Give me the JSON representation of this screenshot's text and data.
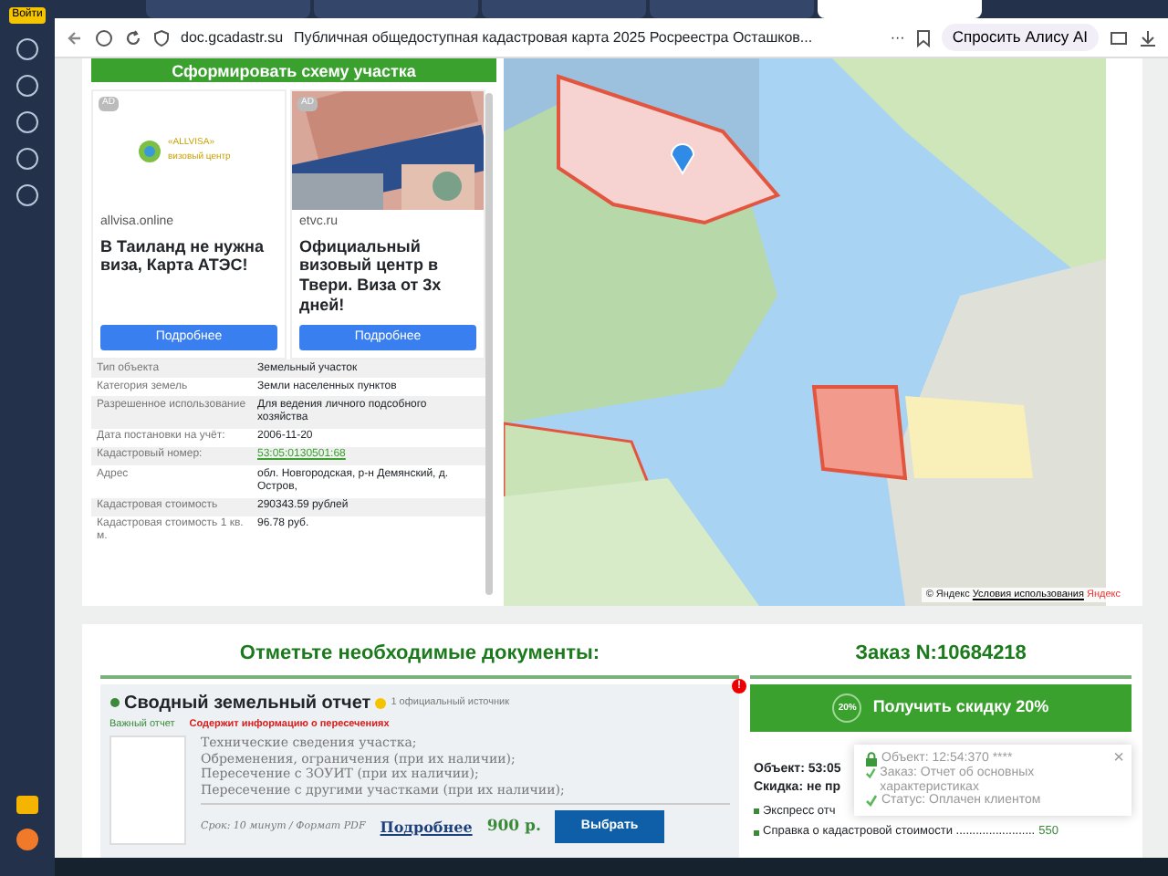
{
  "browser": {
    "login_badge": "Войти",
    "url": "doc.gcadastr.su",
    "page_title": "Публичная общедоступная кадастровая карта 2025 Росреестра Осташков...",
    "more": "···",
    "alice_button": "Спросить Алису AI"
  },
  "tabs": [
    {
      "selected": false
    },
    {
      "selected": false
    },
    {
      "selected": false
    },
    {
      "selected": false
    },
    {
      "selected": true
    }
  ],
  "top_button": "Сформировать схему участка",
  "ads": [
    {
      "ad_mark": "AD",
      "logo_text": "«ALLVISA» визовый центр",
      "domain": "allvisa.online",
      "headline": "В Таиланд не нужна виза, Карта АТЭС!",
      "button": "Подробнее",
      "kind": "logo"
    },
    {
      "ad_mark": "AD",
      "domain": "etvc.ru",
      "headline": "Официальный визовый центр в Твери. Виза от 3х дней!",
      "button": "Подробнее",
      "kind": "picture"
    }
  ],
  "properties": [
    {
      "label": "Тип объекта",
      "value": "Земельный участок",
      "kind": "text"
    },
    {
      "label": "Категория земель",
      "value": "Земли населенных пунктов",
      "kind": "text"
    },
    {
      "label": "Разрешенное использование",
      "value": "Для ведения личного подсобного хозяйства",
      "kind": "text"
    },
    {
      "label": "Дата постановки на учёт:",
      "value": "2006-11-20",
      "kind": "text"
    },
    {
      "label": "Кадастровый номер:",
      "value": "53:05:0130501:68",
      "kind": "link"
    },
    {
      "label": "Адрес",
      "value": "обл. Новгородская, р-н Демянский, д. Остров,",
      "kind": "text"
    },
    {
      "label": "Кадастровая стоимость",
      "value": "290343.59 рублей",
      "kind": "text"
    },
    {
      "label": "Кадастровая стоимость 1 кв. м.",
      "value": "96.78 руб.",
      "kind": "text"
    }
  ],
  "map": {
    "attribution": "© Яндекс",
    "terms_link": "Условия использования",
    "brand": "Яндекс"
  },
  "documents": {
    "heading": "Отметьте необходимые документы:",
    "item": {
      "title": "Сводный земельный отчет",
      "source": "1 официальный источник",
      "tag": "Важный отчет",
      "warning": "Содержит информацию о пересечениях",
      "lines": [
        "Технические сведения участка;",
        "Обременения, ограничения (при их наличии);",
        "Пересечение с ЗОУИТ (при их наличии);",
        "Пересечение с другими участками (при их наличии);"
      ],
      "terms": "Срок: 10 минут / Формат PDF",
      "details_link": "Подробнее",
      "price": "900 р.",
      "select_button": "Выбрать",
      "alert": "!"
    }
  },
  "order": {
    "heading": "Заказ N:10684218",
    "discount_button": "Получить скидку 20%",
    "discount_badge": "20%",
    "object_line": "Объект: 53:05",
    "discount_line": "Скидка: не пр",
    "items": [
      {
        "name": "Экспресс отч"
      },
      {
        "name": "Справка о кадастровой стоимости ........................",
        "price": "550"
      }
    ]
  },
  "toast": {
    "lines": [
      {
        "kind": "lock",
        "text": "Объект: 12:54:370 ****"
      },
      {
        "kind": "check",
        "text": "Заказ: Отчет об основных характеристиках"
      },
      {
        "kind": "check",
        "text": "Статус: Оплачен клиентом"
      }
    ],
    "close": "×"
  }
}
